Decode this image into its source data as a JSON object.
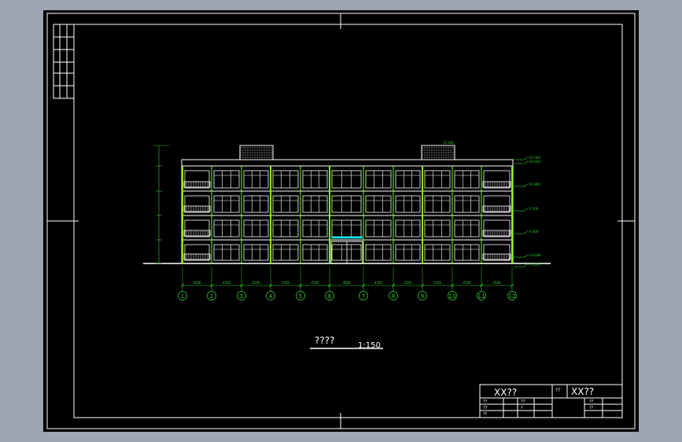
{
  "colors": {
    "background_outer": "#9ea4b1",
    "canvas": "#000000",
    "frame": "#ffffff",
    "building": "#ffffff",
    "columns": "#7cfc00",
    "dimensions": "#33cc33",
    "accent": "#00e5ff",
    "labels": "#ffffff"
  },
  "drawing": {
    "title": "????",
    "scale": "1:150"
  },
  "axes": {
    "labels": [
      "1",
      "2",
      "3",
      "4",
      "5",
      "6",
      "7",
      "8",
      "9",
      "10",
      "11",
      "12"
    ],
    "spans": [
      "4500",
      "4500",
      "4500",
      "4500",
      "4500",
      "3600",
      "4500",
      "4500",
      "4500",
      "4500",
      "4500"
    ]
  },
  "elevations": {
    "levels": [
      "15.300",
      "14.400",
      "10.800",
      "7.200",
      "3.600",
      "±0.000",
      "-1.450"
    ],
    "roof_top": "17.400"
  },
  "title_block": {
    "project_name": "XX??",
    "company_name": "XX??",
    "label_a": "??",
    "rows_left": [
      "??",
      "??",
      "??"
    ],
    "rows_mid": [
      "??",
      "?"
    ],
    "rows_right": [
      "??",
      "??"
    ]
  }
}
